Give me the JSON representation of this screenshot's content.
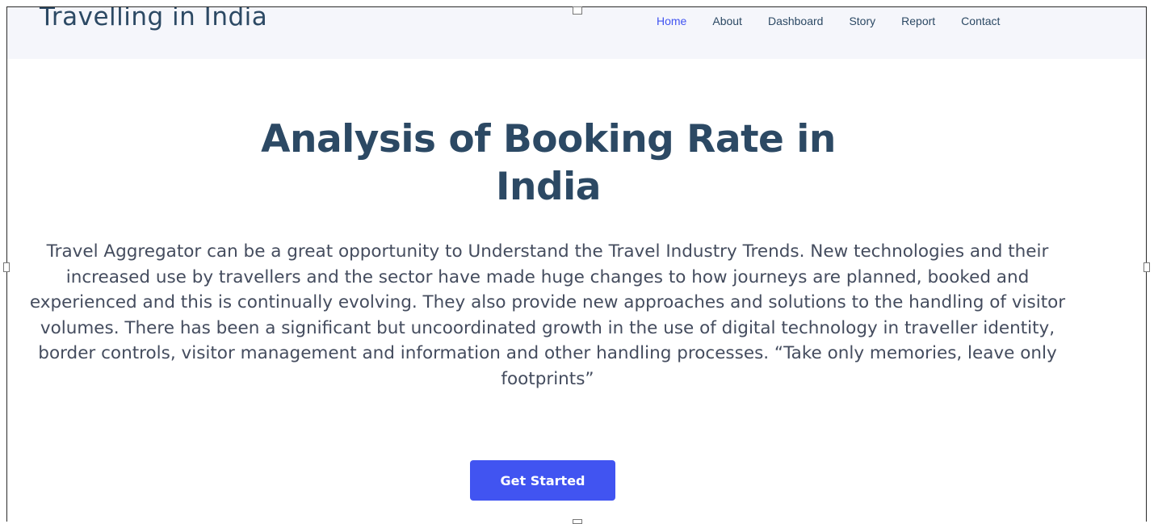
{
  "brand": {
    "name": "Travelling in India"
  },
  "nav": {
    "items": [
      "Home",
      "About",
      "Dashboard",
      "Story",
      "Report",
      "Contact"
    ],
    "active": "Home"
  },
  "hero": {
    "title_line1": "Analysis of Booking Rate in",
    "title_line2": "India",
    "description": "Travel Aggregator can be a great opportunity to Understand the Travel Industry Trends. New technologies and their increased use by travellers and the sector have made huge changes to how journeys are planned, booked and experienced and this is continually evolving. They also provide new approaches and solutions to the handling of visitor volumes. There has been a significant but uncoordinated growth in the use of digital technology in traveller identity, border controls, visitor management and information and other handling processes. “Take only memories, leave only footprints”",
    "cta_label": "Get Started"
  },
  "colors": {
    "accent": "#4154f1",
    "heading": "#2c4964",
    "text": "#444c5e",
    "navbar_bg": "#f5f6fb"
  }
}
